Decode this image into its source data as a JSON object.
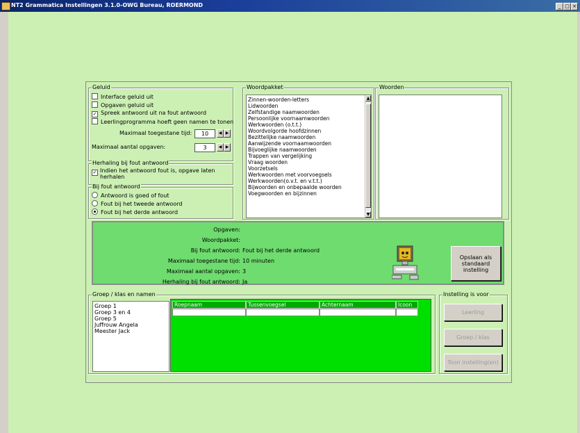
{
  "window": {
    "title": "NT2 Grammatica Instellingen  3.1.0-OWG Bureau, ROERMOND"
  },
  "geluid": {
    "legend": "Geluid",
    "options": [
      {
        "label": "Interface geluid uit",
        "checked": false
      },
      {
        "label": "Opgaven geluid uit",
        "checked": false
      },
      {
        "label": "Spreek antwoord uit na fout antwoord",
        "checked": true
      },
      {
        "label": "Leerlingprogramma hoeft geen namen te tonen",
        "checked": false
      }
    ],
    "max_time_label": "Maximaal toegestane tijd:",
    "max_time_value": "10",
    "max_count_label": "Maximaal aantal opgaven:",
    "max_count_value": "3"
  },
  "herhaling": {
    "legend": "Herhaling bij fout antwoord",
    "label": "Indien het antwoord fout is, opgave laten herhalen",
    "checked": true
  },
  "bij_fout": {
    "legend": "Bij fout antwoord",
    "options": [
      {
        "label": "Antwoord is goed of fout",
        "selected": false
      },
      {
        "label": "Fout bij het tweede antwoord",
        "selected": false
      },
      {
        "label": "Fout bij het derde antwoord",
        "selected": true
      }
    ]
  },
  "woordpakket": {
    "legend": "Woordpakket",
    "items": [
      "Zinnen-woorden-letters",
      "Lidwoorden",
      "Zelfstandige naamwoorden",
      "Persoonlijke voornaamwoorden",
      "Werkwoorden (o.t.t.)",
      "Woordvolgorde hoofdzinnen",
      "Bezittelijke naamwoorden",
      "Aanwijzende voornaamwoorden",
      "Bijvoeglijke naamwoorden",
      "Trappen van vergelijking",
      "Vraag woorden",
      "Voorzetsels",
      "Werkwoorden met voorvoegsels",
      "Werkwoorden(o.v.t. en v.t.t.)",
      "Bijwoorden en onbepaalde woorden",
      "Voegwoorden en bijzinnen"
    ]
  },
  "woorden": {
    "legend": "Woorden",
    "items": []
  },
  "summary": {
    "rows": [
      {
        "label": "Opgaven:",
        "value": ""
      },
      {
        "label": "Woordpakket:",
        "value": ""
      },
      {
        "label": "Bij fout antwoord:",
        "value": "Fout bij het derde antwoord"
      },
      {
        "label": "Maximaal toegestane tijd:",
        "value": "10 minuten"
      },
      {
        "label": "Maximaal aantal opgaven:",
        "value": "3"
      },
      {
        "label": "Herhaling bij fout antwoord:",
        "value": "Ja"
      }
    ],
    "save_button": "Opslaan als standaard instelling"
  },
  "groep": {
    "legend": "Groep / klas en namen",
    "items": [
      "Groep 1",
      "Groep 3 en 4",
      "Groep 5",
      "Juffrouw Angela",
      "Meester Jack"
    ],
    "columns": [
      "Roepnaam",
      "Tussenvoegsel",
      "Achternaam",
      "Icoon"
    ]
  },
  "instelling": {
    "legend": "Instelling is voor",
    "buttons": [
      "Leerling",
      "Groep / klas",
      "Toon instelling(en)"
    ]
  },
  "colors": {
    "background": "#ccf0b4",
    "summary_green": "#6edc6e",
    "grid_green": "#00e000"
  }
}
